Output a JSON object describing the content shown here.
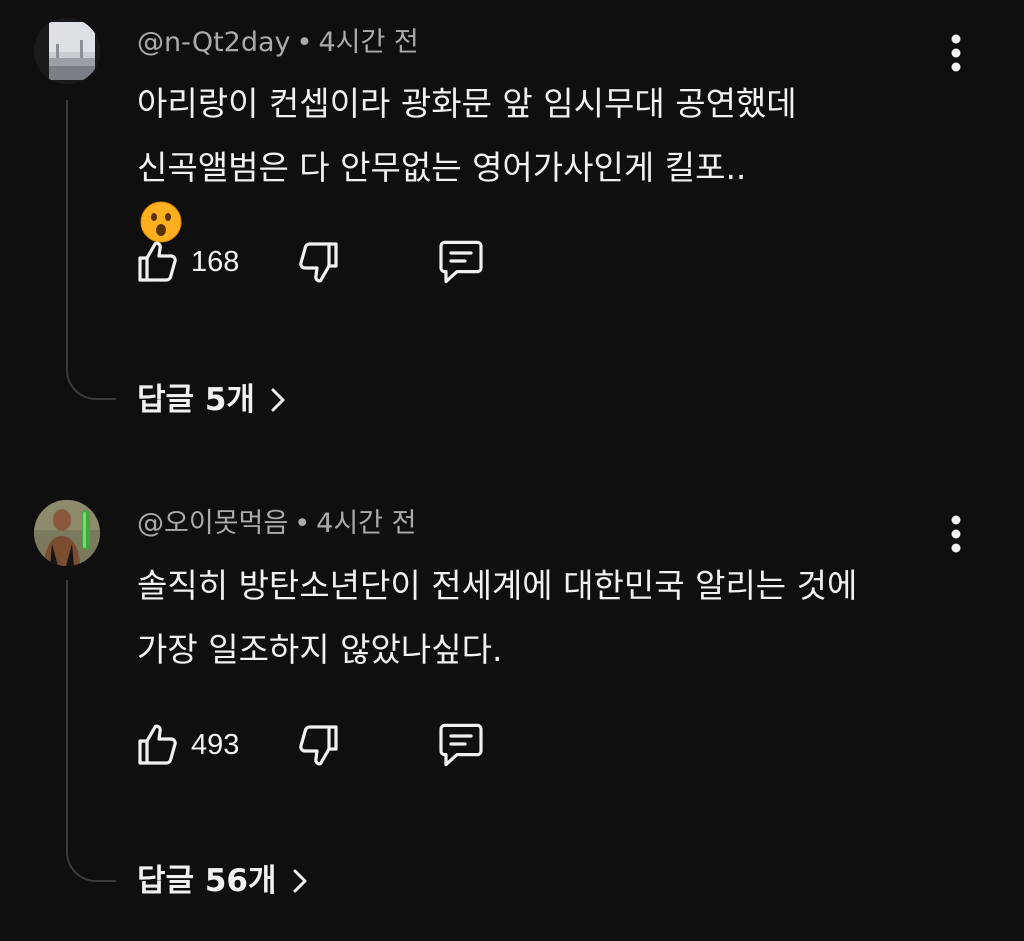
{
  "comments": [
    {
      "handle": "@n-Qt2day",
      "separator": "•",
      "time": "4시간 전",
      "line1": "아리랑이 컨셉이라 광화문 앞 임시무대 공연했데",
      "line2": "신곡앨범은 다 안무없는 영어가사인게 킬포..",
      "emoji": "surprised-face-icon",
      "likes": "168",
      "replies": "답글 5개"
    },
    {
      "handle": "@오이못먹음",
      "separator": "•",
      "time": "4시간 전",
      "line1": "솔직히 방탄소년단이 전세계에 대한민국 알리는 것에",
      "line2": "가장 일조하지 않았나싶다.",
      "likes": "493",
      "replies": "답글 56개"
    }
  ],
  "colors": {
    "background": "#0f0f0f",
    "text": "#f1f1f1",
    "meta": "#aaaaaa",
    "thread": "#3a3a3a",
    "emoji": "#ffb020"
  }
}
